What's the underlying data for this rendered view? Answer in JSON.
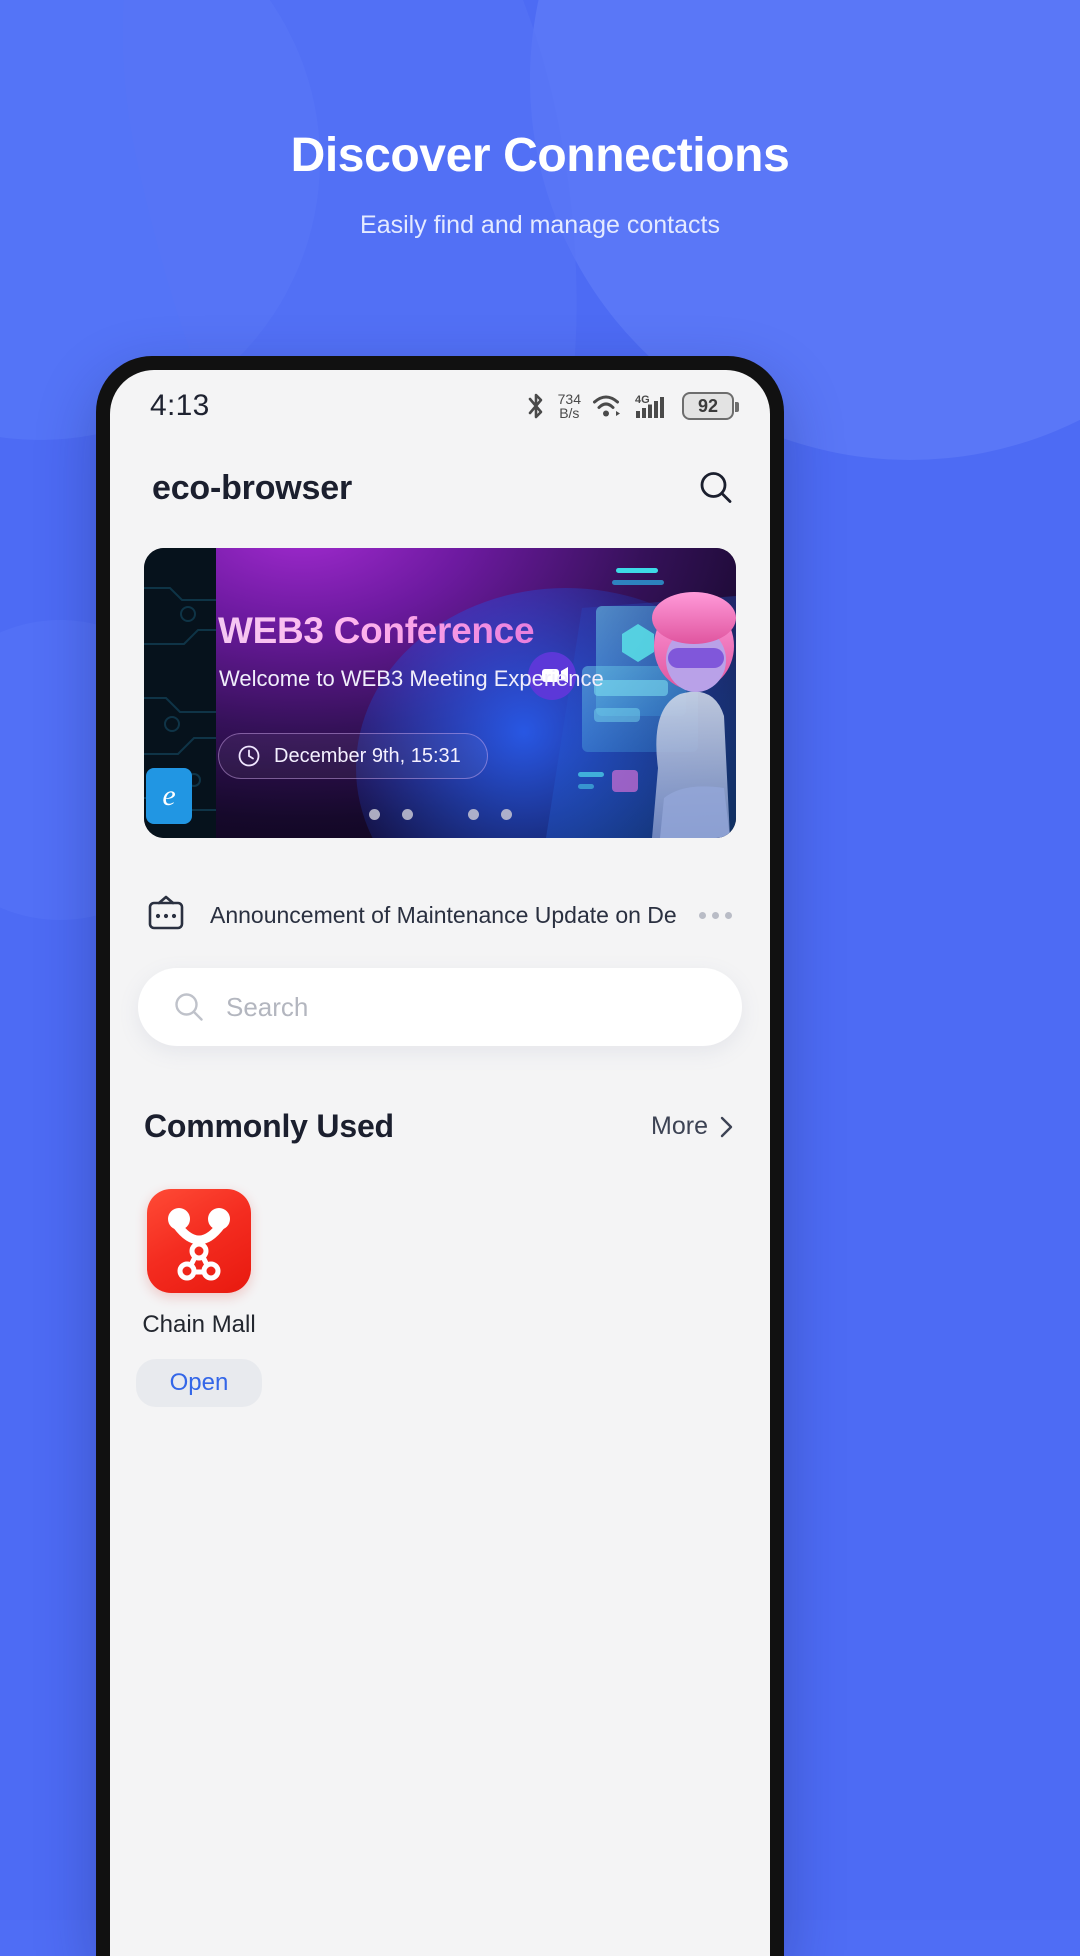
{
  "hero": {
    "title": "Discover Connections",
    "subtitle": "Easily find and manage contacts"
  },
  "colors": {
    "page_background": "#4d6bf4",
    "screen_background": "#f4f4f5",
    "accent_blue": "#3366e8",
    "app_icon_red": "#f42c20",
    "banner_purple": "#6d1aa0"
  },
  "phone": {
    "status_bar": {
      "time": "4:13",
      "bluetooth_icon": "bluetooth-icon",
      "network_speed_value": "734",
      "network_speed_unit": "B/s",
      "wifi_icon": "wifi-icon",
      "mobile_network_label": "4G",
      "signal_icon": "signal-bars-icon",
      "battery_level": "92"
    },
    "app_bar": {
      "title": "eco-browser",
      "search_icon": "search-icon"
    },
    "banner": {
      "title": "WEB3 Conference",
      "subtitle": "Welcome to WEB3 Meeting Experience",
      "time_chip": "December 9th, 15:31",
      "clock_icon": "clock-icon",
      "badge_letter": "e",
      "video_icon": "video-camera-icon",
      "carousel_dots": 4,
      "active_dot_index": 2
    },
    "announcement": {
      "icon": "announcement-board-icon",
      "text": "Announcement of Maintenance Update on Decembe",
      "more_icon": "ellipsis-icon"
    },
    "search": {
      "icon": "search-icon",
      "placeholder": "Search",
      "value": ""
    },
    "commonly_used": {
      "title": "Commonly Used",
      "more_label": "More",
      "more_chevron": "chevron-right-icon",
      "apps": [
        {
          "name": "Chain Mall",
          "action_label": "Open",
          "icon": "chain-mall-bag-icon"
        }
      ]
    }
  }
}
